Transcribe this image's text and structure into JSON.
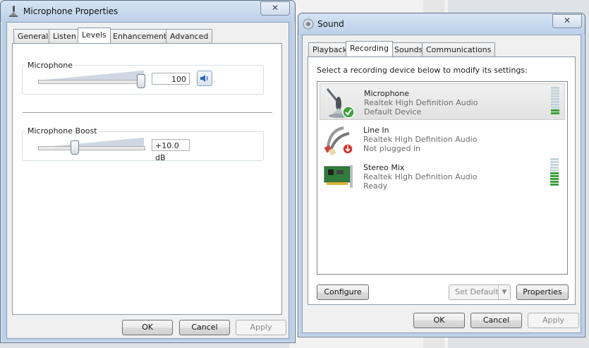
{
  "micprops": {
    "title": "Microphone Properties",
    "close": "✕",
    "tabs": [
      "General",
      "Listen",
      "Levels",
      "Enhancements",
      "Advanced"
    ],
    "active_tab": "Levels",
    "microphone": {
      "label": "Microphone",
      "value": "100",
      "level": 1.0
    },
    "boost": {
      "label": "Microphone Boost",
      "value": "+10.0 dB",
      "level": 0.33
    },
    "buttons": {
      "ok": "OK",
      "cancel": "Cancel",
      "apply": "Apply"
    }
  },
  "sound": {
    "title": "Sound",
    "close": "✕",
    "tabs": [
      "Playback",
      "Recording",
      "Sounds",
      "Communications"
    ],
    "active_tab": "Recording",
    "instruction": "Select a recording device below to modify its settings:",
    "devices": [
      {
        "name": "Microphone",
        "driver": "Realtek High Definition Audio",
        "status": "Default Device",
        "icon": "microphone-icon",
        "selected": true,
        "meter": 2
      },
      {
        "name": "Line In",
        "driver": "Realtek High Definition Audio",
        "status": "Not plugged in",
        "icon": "line-in-jack-icon",
        "selected": false,
        "meter": 0
      },
      {
        "name": "Stereo Mix",
        "driver": "Realtek High Definition Audio",
        "status": "Ready",
        "icon": "sound-card-icon",
        "selected": false,
        "meter": 5
      }
    ],
    "buttons": {
      "configure": "Configure",
      "set_default": "Set Default",
      "properties": "Properties",
      "ok": "OK",
      "cancel": "Cancel",
      "apply": "Apply"
    }
  },
  "colors": {
    "accent": "#3e9f3b",
    "window_frame": "#bcd0e8"
  }
}
